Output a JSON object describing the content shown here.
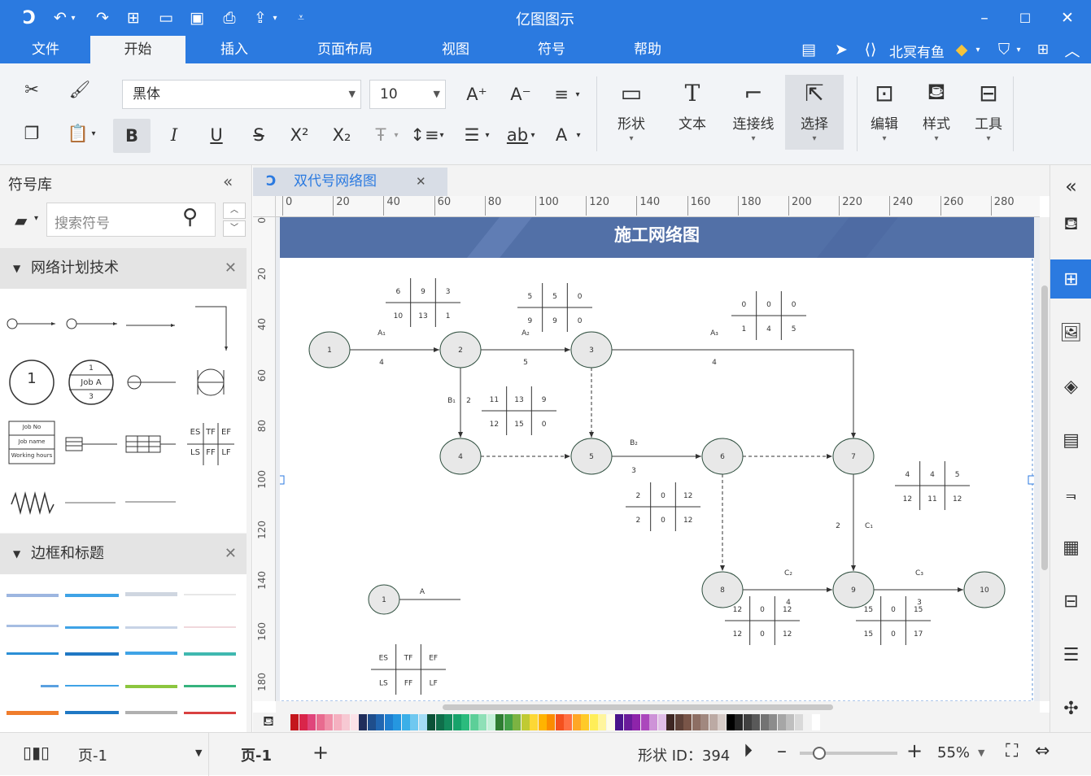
{
  "app": {
    "title": "亿图图示"
  },
  "menus": [
    "文件",
    "开始",
    "插入",
    "页面布局",
    "视图",
    "符号",
    "帮助"
  ],
  "user": {
    "name": "北冥有鱼"
  },
  "ribbon": {
    "font_name": "黑体",
    "font_size": "10",
    "shape_label": "形状",
    "text_label": "文本",
    "connector_label": "连接线",
    "select_label": "选择",
    "edit_label": "编辑",
    "style_label": "样式",
    "tools_label": "工具"
  },
  "library": {
    "title": "符号库",
    "search_placeholder": "搜索符号",
    "section1": "网络计划技术",
    "section2": "边框和标题",
    "sym_circle_number": "1",
    "sym_job": {
      "top": "1",
      "mid": "Job A",
      "bot": "3"
    },
    "sym_jobbox": [
      "Job No",
      "Job name",
      "Working hours"
    ],
    "sym_grid": [
      "ES",
      "TF",
      "EF",
      "LS",
      "FF",
      "LF"
    ]
  },
  "document": {
    "tab_title": "双代号网络图"
  },
  "ruler": {
    "h": [
      "0",
      "20",
      "40",
      "60",
      "80",
      "100",
      "120",
      "140",
      "160",
      "180",
      "200",
      "220",
      "240",
      "260",
      "280"
    ],
    "v": [
      "0",
      "20",
      "40",
      "60",
      "80",
      "100",
      "120",
      "140",
      "160",
      "180"
    ]
  },
  "diagram": {
    "title": "施工网络图",
    "nodes": [
      "1",
      "2",
      "3",
      "4",
      "5",
      "6",
      "7",
      "8",
      "9",
      "10"
    ],
    "activities": [
      {
        "name": "A₁",
        "duration": "4"
      },
      {
        "name": "A₂",
        "duration": "5"
      },
      {
        "name": "A₃",
        "duration": "4"
      },
      {
        "name": "B₁",
        "duration": "2"
      },
      {
        "name": "B₂",
        "duration": "3"
      },
      {
        "name": "C₁",
        "duration": "2"
      },
      {
        "name": "C₂",
        "duration": "4"
      },
      {
        "name": "C₃",
        "duration": "3"
      }
    ],
    "tables": [
      {
        "top": [
          "6",
          "9",
          "3"
        ],
        "bot": [
          "10",
          "13",
          "1"
        ]
      },
      {
        "top": [
          "5",
          "5",
          "0"
        ],
        "bot": [
          "9",
          "9",
          "0"
        ]
      },
      {
        "top": [
          "0",
          "0",
          "0"
        ],
        "bot": [
          "1",
          "4",
          "5"
        ]
      },
      {
        "top": [
          "11",
          "13",
          "9"
        ],
        "bot": [
          "12",
          "15",
          "0"
        ]
      },
      {
        "top": [
          "2",
          "0",
          "12"
        ],
        "bot": [
          "2",
          "0",
          "12"
        ]
      },
      {
        "top": [
          "4",
          "4",
          "5"
        ],
        "bot": [
          "12",
          "11",
          "12"
        ]
      },
      {
        "top": [
          "12",
          "0",
          "12"
        ],
        "bot": [
          "12",
          "0",
          "12"
        ]
      },
      {
        "top": [
          "15",
          "0",
          "15"
        ],
        "bot": [
          "15",
          "0",
          "17"
        ]
      }
    ],
    "legend": {
      "node": "1",
      "activity": "A",
      "grid": [
        "ES",
        "TF",
        "EF",
        "LS",
        "FF",
        "LF"
      ]
    }
  },
  "status": {
    "page_selector": "页-1",
    "page_tab": "页-1",
    "shape_id": "形状 ID：394",
    "zoom": "55%",
    "zoom_level": 0.2
  },
  "colors": {
    "accent": "#2b7ae0",
    "banner": "#5270a7"
  }
}
